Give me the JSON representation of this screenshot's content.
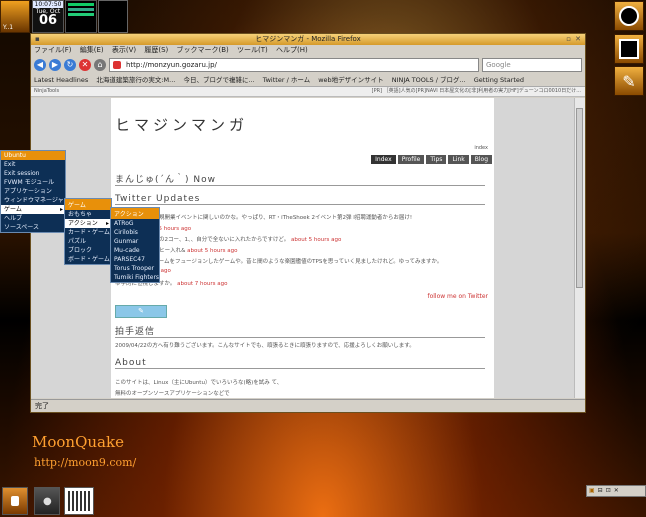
{
  "desktop": {
    "dock_left_label": "Y..1",
    "clock": {
      "time": "10:07:50",
      "date_label": "Tue, Oct",
      "day": "06"
    },
    "watermark_title": "MoonQuake",
    "watermark_url": "http://moon9.com/"
  },
  "window": {
    "title": "ヒマジンマンガ - Mozilla Firefox",
    "menu": [
      "ファイル(F)",
      "編集(E)",
      "表示(V)",
      "履歴(S)",
      "ブックマーク(B)",
      "ツール(T)",
      "ヘルプ(H)"
    ],
    "url": "http://monzyun.gozaru.jp/",
    "search_placeholder": "Google",
    "bookmarks": [
      "Latest Headlines",
      "北海道建築旅行の実文:M...",
      "今日、ブログで複雑に...",
      "Twitter / ホーム",
      "web地デザインサイト",
      "NINJA TOOLS / ブログ...",
      "Getting Started"
    ],
    "toolbar2_left": "NinjaTools",
    "toolbar2_right": "[PR] ［英語]人気の[PR]NAVI  日本屋文化の[非]利用者の実力[HF]デューンコロ0010日だけ...",
    "status": "完了"
  },
  "page": {
    "site_title": "ヒマジンマンガ",
    "index_label": "index",
    "tabs": [
      "Index",
      "Profile",
      "Tips",
      "Link",
      "Blog"
    ],
    "section_now": "まんじゅ(´ん｀) Now",
    "section_twitter": "Twitter Updates",
    "tweets": [
      {
        "text": "本社では、大阪新規開業イベントに関しいのかな。やっぱり、RT・iTheShoek 2イベント第2弾 I招聘運動者からお届け!",
        "ts": ""
      },
      {
        "text": "　Mun2e about 5 hours ago",
        "ts": ""
      },
      {
        "text": "口に合わないものの2コー、1、、自分で全ないに入れたからですけど。",
        "ts": "about 5 hours ago"
      },
      {
        "text": "味ばかりの　コーヒー入れ&",
        "ts": "about 5 hours ago"
      },
      {
        "text": "シューティングゲームをフュージョンしたゲームや。昔と間のような楽園艦値のTPSを思っていく見ましたけれど。ゆってみますか。",
        "ts": ""
      },
      {
        "text": "C",
        "ts": "about 5 hours ago"
      },
      {
        "text": "ゆ学的に位視しますか。",
        "ts": "about 7 hours ago"
      }
    ],
    "follow": "follow me on Twitter",
    "section_reply": "拍手返信",
    "reply_text": "2009/04/22の方へ有り難うございます。こんなサイトでも、頑張るときに頑張りますので、応援よろしくお願いします。",
    "section_about": "About",
    "about_lines": [
      "このサイトは、Linux（主にUbuntu）でいろいろな(略)を試み て、",
      "無料のオープンソースアプリケーションなどで"
    ]
  },
  "menus": {
    "main": {
      "header": "Ubuntu",
      "items": [
        "Exit",
        "Exit session",
        "FVWM モジュール",
        "アプリケーション",
        "ウィンドウマネージャ",
        "ゲーム",
        "ヘルプ",
        "ソースペース"
      ],
      "selected": "ゲーム"
    },
    "games": {
      "header": "ゲーム",
      "items": [
        "おもちゃ",
        "アクション",
        "カード・ゲーム",
        "パズル",
        "ブロック",
        "ボード・ゲーム"
      ],
      "selected": "アクション"
    },
    "action": {
      "header": "アクション",
      "items": [
        "ATRoG",
        "Cirilobis",
        "Gunmar",
        "Mu-cade",
        "PARSEC47",
        "Torus Trooper",
        "Tumiki Fighters"
      ]
    }
  }
}
